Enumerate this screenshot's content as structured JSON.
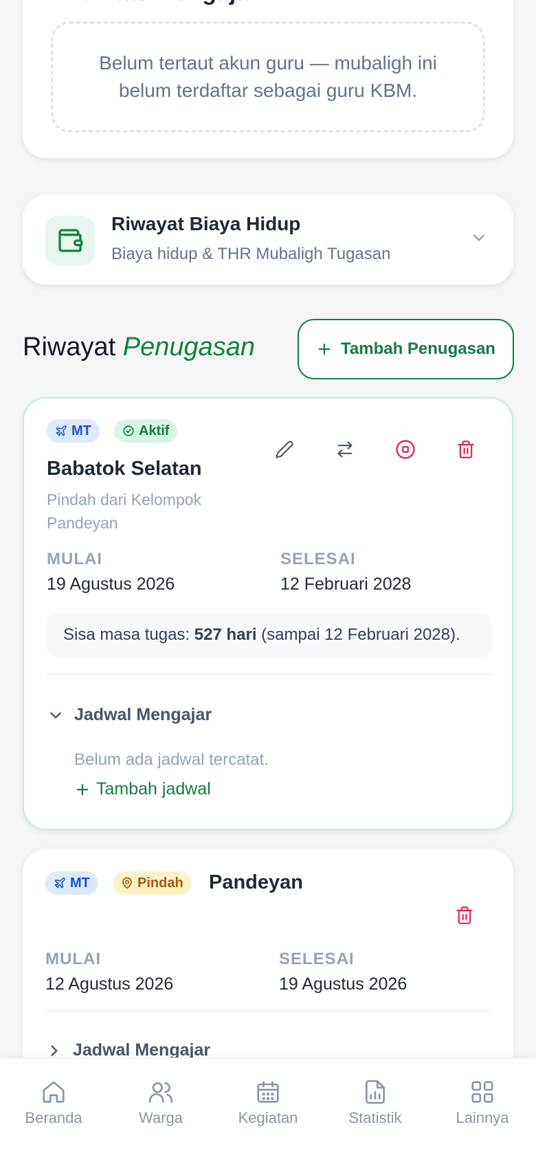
{
  "kbm": {
    "title": "Aktivitas Mengajar KBM",
    "empty_text": "Belum tertaut akun guru — mubaligh ini belum terdaftar sebagai guru KBM."
  },
  "biaya_hidup": {
    "title": "Riwayat Biaya Hidup",
    "subtitle": "Biaya hidup & THR Mubaligh Tugasan"
  },
  "penugasan_section": {
    "title_plain": "Riwayat",
    "title_accent": "Penugasan",
    "add_label": "Tambah Penugasan"
  },
  "assignments": [
    {
      "type_badge": "MT",
      "status_badge": "Aktif",
      "location": "Babatok Selatan",
      "from_text": "Pindah dari Kelompok Pandeyan",
      "start_label": "MULAI",
      "start_value": "19 Agustus 2026",
      "end_label": "SELESAI",
      "end_value": "12 Februari 2028",
      "remain_prefix": "Sisa masa tugas:",
      "remain_days": "527 hari",
      "remain_suffix": "(sampai 12 Februari 2028).",
      "schedule_title": "Jadwal Mengajar",
      "schedule_empty": "Belum ada jadwal tercatat.",
      "schedule_add": "Tambah jadwal"
    },
    {
      "type_badge": "MT",
      "status_badge": "Pindah",
      "location": "Pandeyan",
      "start_label": "MULAI",
      "start_value": "12 Agustus 2026",
      "end_label": "SELESAI",
      "end_value": "19 Agustus 2026",
      "schedule_title": "Jadwal Mengajar"
    }
  ],
  "nav": {
    "items": [
      {
        "label": "Beranda",
        "icon": "home-icon"
      },
      {
        "label": "Warga",
        "icon": "users-icon"
      },
      {
        "label": "Kegiatan",
        "icon": "calendar-icon"
      },
      {
        "label": "Statistik",
        "icon": "chart-icon"
      },
      {
        "label": "Lainnya",
        "icon": "grid-icon"
      }
    ]
  },
  "colors": {
    "accent_green": "#15803d",
    "danger": "#e11d48",
    "muted": "#94a3b8"
  }
}
